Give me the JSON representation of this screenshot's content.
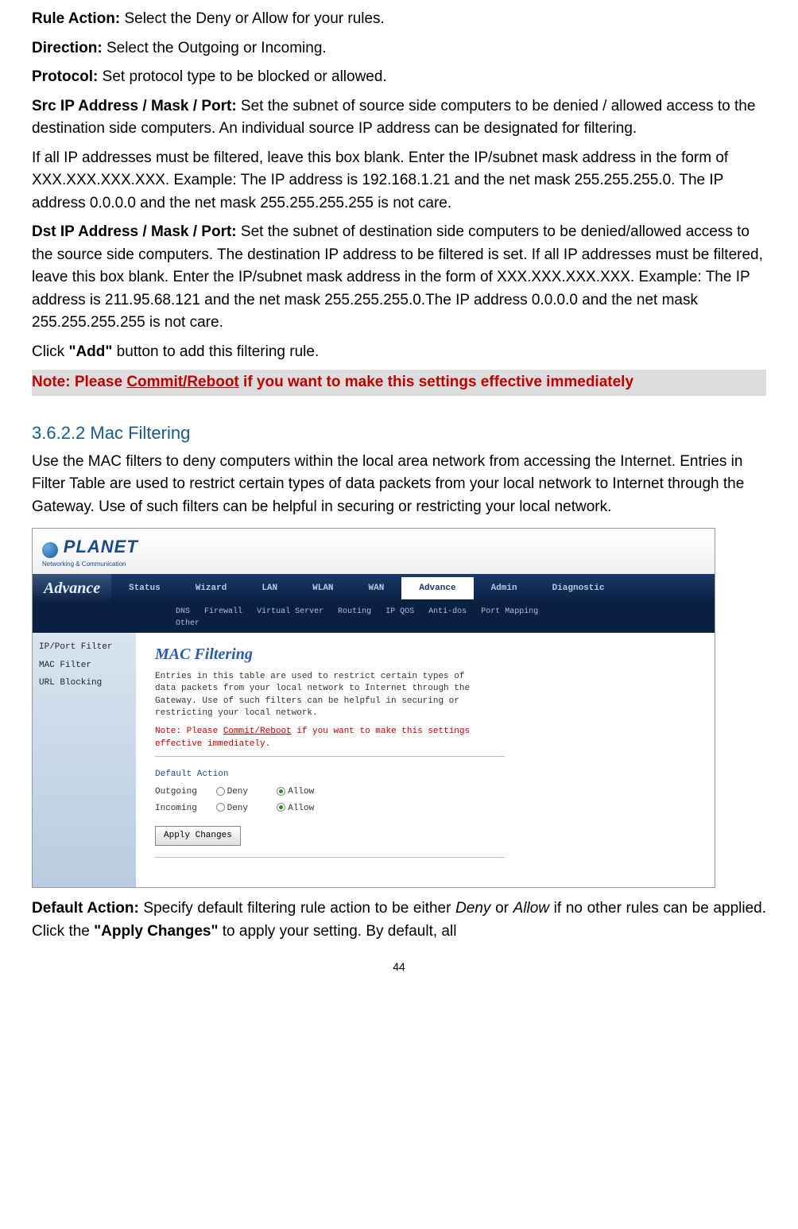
{
  "p1": {
    "label": "Rule Action:",
    "text": " Select the Deny or Allow for your rules."
  },
  "p2": {
    "label": "Direction:",
    "text": " Select the Outgoing or Incoming."
  },
  "p3": {
    "label": "Protocol:",
    "text": " Set protocol type to be blocked or allowed."
  },
  "p4": {
    "label": "Src IP Address / Mask / Port:",
    "text": " Set the subnet of source side computers to be denied / allowed access to the destination side computers. An individual source IP address can be designated for filtering."
  },
  "p5": "If all IP addresses must be filtered, leave this box blank. Enter the IP/subnet mask address in the form of XXX.XXX.XXX.XXX. Example: The IP address is 192.168.1.21 and the net mask 255.255.255.0. The IP address 0.0.0.0 and the net mask 255.255.255.255 is not care.",
  "p6": {
    "label": "Dst IP Address / Mask / Port:",
    "text": " Set the subnet of destination side computers to be denied/allowed access to the source side computers. The destination IP address to be filtered is set. If all IP addresses must be filtered, leave this box blank. Enter the IP/subnet mask address in the form of XXX.XXX.XXX.XXX. Example: The IP address is 211.95.68.121 and the net mask 255.255.255.0.The IP address 0.0.0.0 and the net mask 255.255.255.255 is not care."
  },
  "p7": {
    "pre": "Click ",
    "bold": "\"Add\"",
    "post": " button to add this filtering rule."
  },
  "note1": {
    "pre": "Note: Please ",
    "u": "Commit/Reboot",
    "post": " if you want to make this settings effective immediately"
  },
  "section": "3.6.2.2 Mac Filtering",
  "p8": "Use the MAC filters to deny computers within the local area network from accessing the Internet. Entries in Filter Table are used to restrict certain types of data packets from your local network to Internet through the Gateway. Use of such filters can be helpful in securing or restricting your local network.",
  "shot": {
    "logo": "PLANET",
    "logosub": "Networking & Communication",
    "navtitle": "Advance",
    "nav": [
      "Status",
      "Wizard",
      "LAN",
      "WLAN",
      "WAN",
      "Advance",
      "Admin",
      "Diagnostic"
    ],
    "subnav": [
      "DNS",
      "Firewall",
      "Virtual Server",
      "Routing",
      "IP QOS",
      "Anti-dos",
      "Port Mapping",
      "Other"
    ],
    "side": [
      "IP/Port Filter",
      "MAC Filter",
      "URL Blocking"
    ],
    "title": "MAC Filtering",
    "desc": "Entries in this table are used to restrict certain types of data packets from your local network to Internet through the Gateway. Use of such filters can be helpful in securing or restricting your local network.",
    "notepre": "Note: Please ",
    "noteu": "Commit/Reboot",
    "notepost": " if you want to make this settings effective immediately.",
    "default": "Default Action",
    "out": "Outgoing",
    "in": "Incoming",
    "deny": "Deny",
    "allow": "Allow",
    "apply": "Apply Changes"
  },
  "p9": {
    "label": "Default Action:",
    "t1": " Specify default filtering rule action to be either ",
    "i1": "Deny",
    "t2": " or ",
    "i2": "Allow",
    "t3": " if no other rules can be applied. Click the ",
    "b1": "\"Apply Changes\"",
    "t4": " to apply your setting. By default, all"
  },
  "pagenum": "44"
}
